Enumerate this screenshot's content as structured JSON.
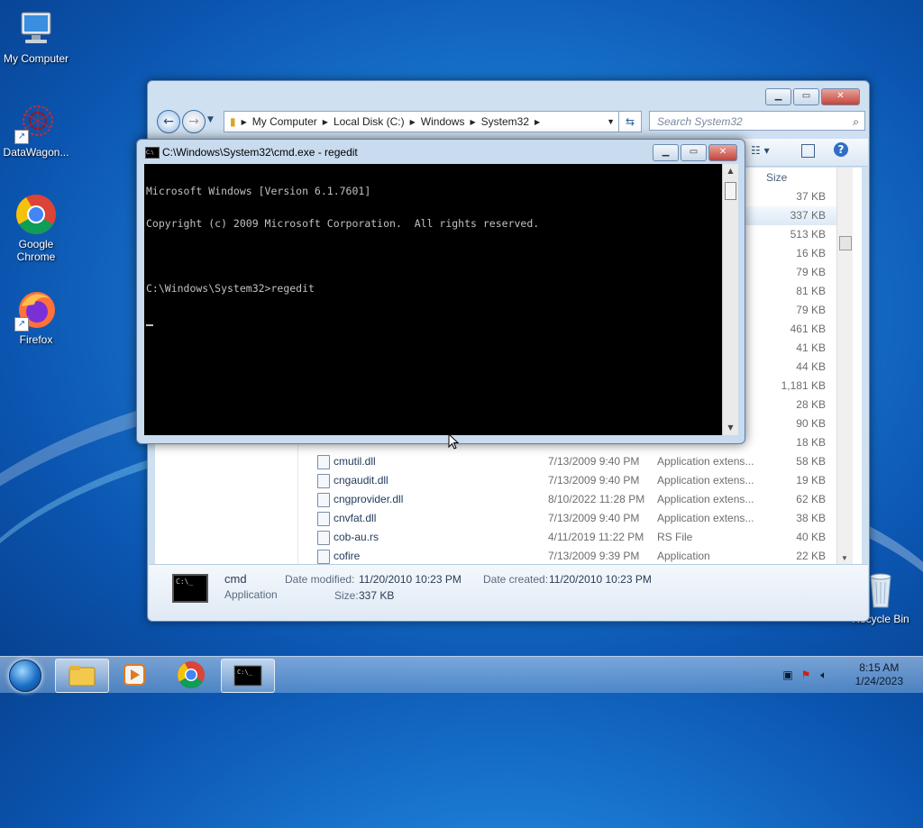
{
  "desktop": {
    "icons": [
      {
        "label": "My Computer",
        "icon": "computer-icon"
      },
      {
        "label": "DataWagon...",
        "icon": "datawagon-icon"
      },
      {
        "label": "Google Chrome",
        "icon": "chrome-icon"
      },
      {
        "label": "Firefox",
        "icon": "firefox-icon"
      },
      {
        "label": "Recycle Bin",
        "icon": "recycle-bin-icon"
      }
    ]
  },
  "explorer": {
    "breadcrumb": [
      "My Computer",
      "Local Disk (C:)",
      "Windows",
      "System32"
    ],
    "search_placeholder": "Search System32",
    "column_size": "Size",
    "rows_top": [
      {
        "size": "37 KB"
      },
      {
        "size": "337 KB"
      },
      {
        "size": "513 KB"
      },
      {
        "size": "16 KB"
      },
      {
        "size": "79 KB"
      },
      {
        "size": "81 KB"
      },
      {
        "size": "79 KB"
      },
      {
        "size": "461 KB"
      },
      {
        "size": "41 KB"
      },
      {
        "size": "44 KB"
      },
      {
        "size": "1,181 KB"
      },
      {
        "size": "28 KB"
      },
      {
        "size": "90 KB"
      },
      {
        "size": "18 KB"
      }
    ],
    "rows": [
      {
        "name": "cmutil.dll",
        "date": "7/13/2009 9:40 PM",
        "type": "Application extens...",
        "size": "58 KB"
      },
      {
        "name": "cngaudit.dll",
        "date": "7/13/2009 9:40 PM",
        "type": "Application extens...",
        "size": "19 KB"
      },
      {
        "name": "cngprovider.dll",
        "date": "8/10/2022 11:28 PM",
        "type": "Application extens...",
        "size": "62 KB"
      },
      {
        "name": "cnvfat.dll",
        "date": "7/13/2009 9:40 PM",
        "type": "Application extens...",
        "size": "38 KB"
      },
      {
        "name": "cob-au.rs",
        "date": "4/11/2019 11:22 PM",
        "type": "RS File",
        "size": "40 KB"
      },
      {
        "name": "cofire",
        "date": "7/13/2009 9:39 PM",
        "type": "Application",
        "size": "22 KB"
      }
    ],
    "details": {
      "name": "cmd",
      "kind": "Application",
      "date_modified_label": "Date modified:",
      "date_modified": "11/20/2010 10:23 PM",
      "date_created_label": "Date created:",
      "date_created": "11/20/2010 10:23 PM",
      "size_label": "Size:",
      "size": "337 KB"
    }
  },
  "cmd": {
    "title": "C:\\Windows\\System32\\cmd.exe - regedit",
    "lines": [
      "Microsoft Windows [Version 6.1.7601]",
      "Copyright (c) 2009 Microsoft Corporation.  All rights reserved.",
      "",
      "C:\\Windows\\System32>regedit"
    ]
  },
  "taskbar": {
    "time": "8:15 AM",
    "date": "1/24/2023"
  }
}
